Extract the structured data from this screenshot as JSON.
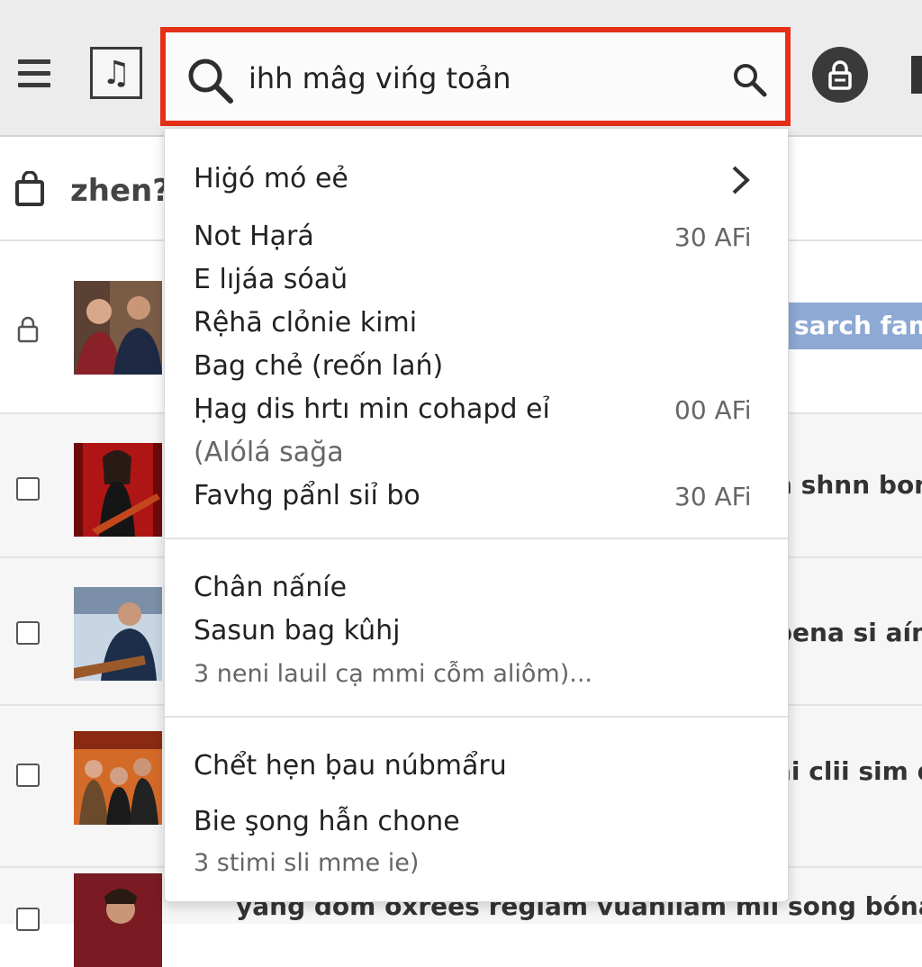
{
  "search": {
    "value": "ihh mâg vińg toản"
  },
  "subheader": {
    "title": "zhen?"
  },
  "dropdown": {
    "header": "Hiġó mó eẻ",
    "recent": [
      {
        "label": "Not Hạrá",
        "time": "30 AFi"
      },
      {
        "label": "E lıjáa  sóaŭ",
        "time": ""
      },
      {
        "label": "Rệhā clỏnie kimi",
        "time": ""
      },
      {
        "label": "Bag chẻ (reốn lań)",
        "time": ""
      },
      {
        "label": "Ḥag dis hrtı min cohapd eỉ",
        "time": "00 AFi"
      },
      {
        "label": "(Alólá sağa",
        "time": ""
      },
      {
        "label": "Favhg pẩnl siỉ bo",
        "time": "30 AFi"
      }
    ],
    "group2": {
      "line1": "Chân nấníe",
      "line2": "Sasun bag kûhj",
      "meta": "3 neni lauil cạ mmi cỗm aliôm)..."
    },
    "group3": {
      "line1": "Chểt hẹn ḅau núbmẩru",
      "line2": "Bie şong hẫn chone",
      "meta": "3 stimi sli mme ie)"
    }
  },
  "rows": [
    {
      "text": "sarch fam"
    },
    {
      "text": "n shnn bon"
    },
    {
      "text": "bena si aím"
    },
    {
      "text": "ai clii sim d"
    }
  ],
  "bottom_text": "yang dom oxrees regiam vuaniiam mii song bóna'll li"
}
